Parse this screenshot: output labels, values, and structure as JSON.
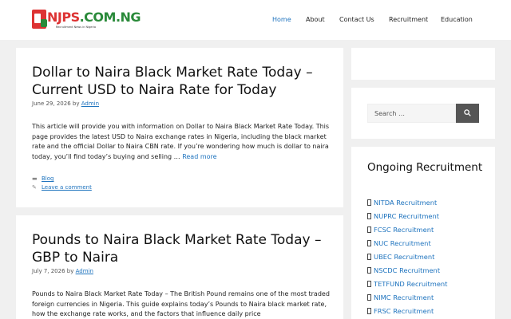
{
  "site": {
    "logo_main": "NJPS",
    "logo_suffix": ".COM.NG",
    "logo_tagline": "Recruitment News in Nigeria"
  },
  "nav": {
    "items": [
      {
        "label": "Home",
        "active": true
      },
      {
        "label": "About"
      },
      {
        "label": "Contact Us"
      },
      {
        "label": "Recruitment"
      },
      {
        "label": "Education"
      }
    ]
  },
  "posts": [
    {
      "title": "Dollar to Naira Black Market Rate Today – Current USD to Naira Rate for Today",
      "date": "June 29, 2026",
      "by": "by",
      "author": "Admin",
      "excerpt": "This article will provide you with information on  Dollar to Naira Black Market Rate Today. This page provides the latest USD to Naira exchange rates in Nigeria, including the black market rate and the official Dollar to Naira CBN rate. If you’re wondering how much is dollar to naira today, you’ll find today’s buying and selling …",
      "read_more": "Read more",
      "category": "Blog",
      "comment": "Leave a comment"
    },
    {
      "title": "Pounds to Naira Black Market Rate Today – GBP to Naira",
      "date": "July 7, 2026",
      "by": "by",
      "author": "Admin",
      "excerpt": "Pounds to Naira Black Market Rate Today – The British Pound remains one of the most traded foreign currencies in Nigeria. This guide explains today’s Pounds to Naira black market rate, how the exchange rate works, and the factors that influence daily price"
    }
  ],
  "sidebar": {
    "search_placeholder": "Search …",
    "recruitment_title": "Ongoing Recruitment",
    "recruitment_items": [
      "NITDA Recruitment",
      "NUPRC Recruitment",
      "FCSC Recruitment",
      "NUC Recruitment",
      "UBEC Recruitment",
      "NSCDC Recruitment",
      "TETFUND Recruitment",
      "NIMC Recruitment",
      "FRSC Recruitment"
    ]
  },
  "colors": {
    "accent": "#1e73be",
    "logo_red": "#dd3333",
    "logo_green": "#2a8a3a",
    "search_button": "#555555",
    "background": "#f0f0f0"
  }
}
